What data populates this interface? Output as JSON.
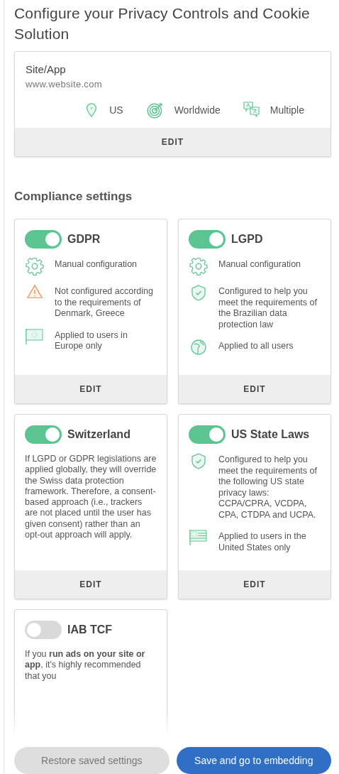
{
  "title": "Configure your Privacy Controls and Cookie Solution",
  "site": {
    "label": "Site/App",
    "url": "www.website.com",
    "details": [
      {
        "kind": "pin",
        "text": "US"
      },
      {
        "kind": "target",
        "text": "Worldwide"
      },
      {
        "kind": "translate",
        "text": "Multiple"
      }
    ],
    "action": "EDIT"
  },
  "compliance": {
    "heading": "Compliance settings",
    "cards": [
      {
        "name": "GDPR",
        "on": true,
        "kind": "list",
        "items": [
          {
            "kind": "gear",
            "text": "Manual configuration"
          },
          {
            "kind": "warning",
            "text": "Not configured according to the requirements of Denmark, Greece"
          },
          {
            "kind": "flag",
            "text": "Applied to users in Europe only"
          }
        ],
        "action": "EDIT"
      },
      {
        "name": "LGPD",
        "on": true,
        "kind": "list",
        "items": [
          {
            "kind": "gear",
            "text": "Manual configuration"
          },
          {
            "kind": "shield",
            "text": "Configured to help you meet the requirements of the Brazilian data protection law"
          },
          {
            "kind": "globe",
            "text": "Applied to all users"
          }
        ],
        "action": "EDIT"
      },
      {
        "name": "Switzerland",
        "on": true,
        "kind": "text",
        "text": "If LGPD or GDPR legislations are applied globally, they will override the Swiss data protection framework. Therefore, a consent-based approach (i.e., trackers are not placed until the user has given consent) rather than an opt-out approach will apply.",
        "action": "EDIT"
      },
      {
        "name": "US State Laws",
        "on": true,
        "kind": "list",
        "items": [
          {
            "kind": "shield",
            "text": "Configured to help you meet the requirements of the following US state privacy laws: CCPA/CPRA, VCDPA, CPA, CTDPA and UCPA."
          },
          {
            "kind": "stripes",
            "text": "Applied to users in the United States only"
          }
        ],
        "action": "EDIT"
      },
      {
        "name": "IAB TCF",
        "on": false,
        "kind": "text",
        "text": "If you **run ads on your site or app**, it's highly recommended that you"
      }
    ]
  },
  "buttons": {
    "restore": "Restore saved settings",
    "save": "Save and go to embedding"
  }
}
